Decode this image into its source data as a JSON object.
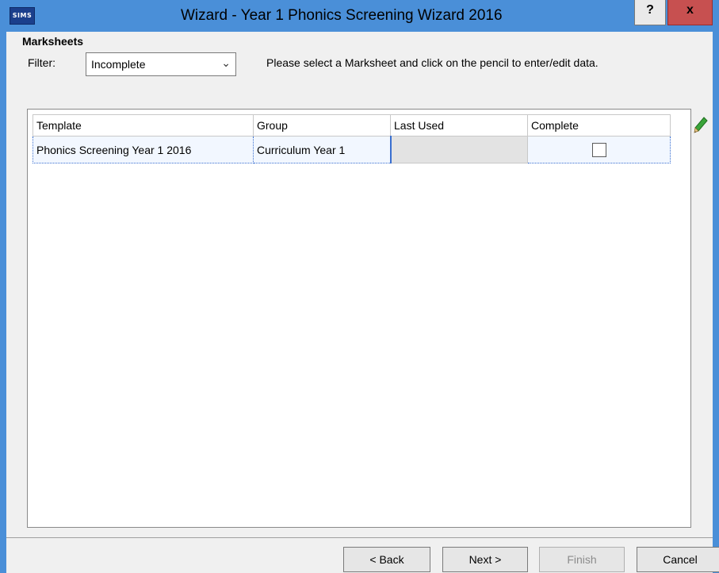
{
  "window": {
    "icon_text": "SIMS",
    "title": "Wizard - Year 1 Phonics Screening Wizard 2016",
    "help_label": "?",
    "close_label": "x"
  },
  "section_title": "Marksheets",
  "filter": {
    "label": "Filter:",
    "selected": "Incomplete"
  },
  "instruction": "Please select a Marksheet and click on the pencil to enter/edit data.",
  "grid": {
    "columns": [
      "Template",
      "Group",
      "Last Used",
      "Complete"
    ],
    "rows": [
      {
        "template": "Phonics Screening Year 1 2016",
        "group": "Curriculum Year  1",
        "last_used": "",
        "complete": false
      }
    ]
  },
  "buttons": {
    "back": "< Back",
    "next": "Next >",
    "finish": "Finish",
    "cancel": "Cancel"
  },
  "colors": {
    "titlebar": "#4a8fd8",
    "close": "#c75050",
    "pencil": "#3aa53a"
  },
  "icons": [
    "sims-logo-icon",
    "pencil-icon",
    "chevron-down-icon"
  ]
}
